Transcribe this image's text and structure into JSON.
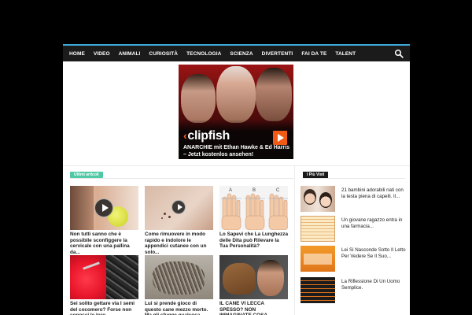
{
  "nav": {
    "items": [
      "HOME",
      "VIDEO",
      "ANIMALI",
      "CURIOSITÀ",
      "TECNOLOGIA",
      "SCIENZA",
      "DIVERTENTI",
      "FAI DA TE",
      "TALENT"
    ],
    "search_icon": "search-icon",
    "accent": "#3fa9d8"
  },
  "ad": {
    "brand": "clipfish",
    "text": "ANARCHIE mit  Ethan Hawke & Ed Harris – Jetzt kostenlos ansehen!",
    "accent": "#f05a14"
  },
  "main": {
    "section_label": "Ultimi articoli",
    "accent": "#4ec9a4",
    "articles": [
      {
        "title": "Non tutti sanno che è possibile sconfiggere la cervicale con una pallina da..."
      },
      {
        "title": "Come rimuovere in modo rapido e indolore le appendici cutanee con un solo..."
      },
      {
        "title": "Lo Sapevi che La Lunghezza delle Dita può Rilevare la Tua Personalità?",
        "finger_labels": [
          "A",
          "B",
          "C"
        ]
      },
      {
        "title": "Sei solito gettare via I semi del cocomero? Forse non conosci le loro..."
      },
      {
        "title": "Lui si prende gioco di questo cane mezzo morto. Ma gli sfugge qualcosa..."
      },
      {
        "title": "IL CANE VI LECCA SPESSO? NON IMMAGINATE COSA SUCCEDE: UNA SCOPERTA INCREDIBILE"
      }
    ]
  },
  "sidebar": {
    "section_label": "I Più Visti",
    "items": [
      {
        "title": "21 bambini adorabili nati con la testa piena di capelli. Il..."
      },
      {
        "title": "Un giovane ragazzo entra in una farmacia..."
      },
      {
        "title": "Lei Si Nasconde Sotto Il Letto Per Vedere Se Il Suo..."
      },
      {
        "title": "La Riflessione Di Un Uomo Semplice."
      }
    ]
  }
}
